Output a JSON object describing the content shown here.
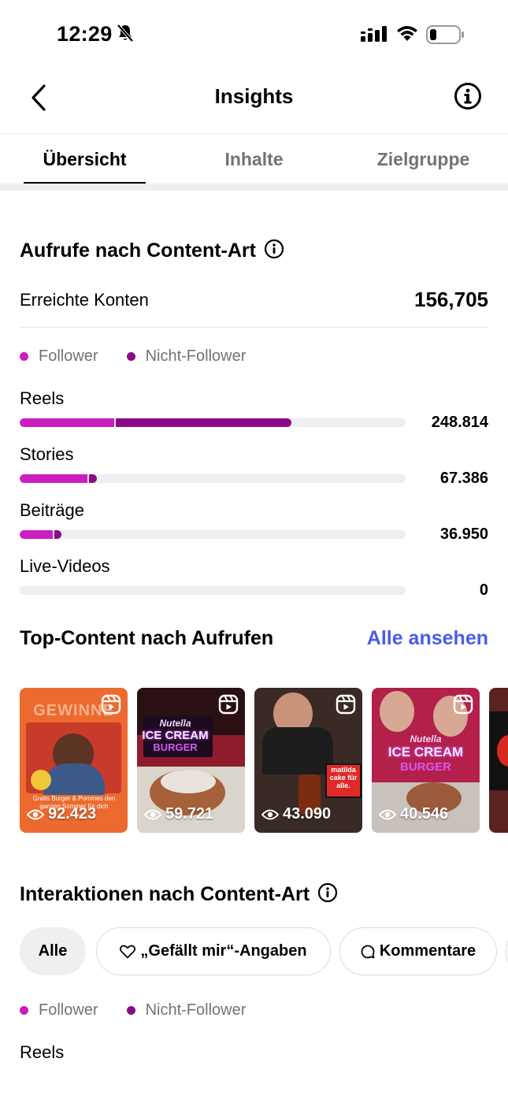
{
  "status_bar": {
    "time": "12:29"
  },
  "header": {
    "title": "Insights"
  },
  "tabs": [
    {
      "label": "Übersicht",
      "active": true
    },
    {
      "label": "Inhalte",
      "active": false
    },
    {
      "label": "Zielgruppe",
      "active": false
    }
  ],
  "views_section": {
    "title": "Aufrufe nach Content-Art",
    "reach_label": "Erreichte Konten",
    "reach_value": "156,705",
    "legend": {
      "follower": "Follower",
      "non_follower": "Nicht-Follower"
    },
    "colors": {
      "follower": "#cc1dbf",
      "non_follower": "#8b0b86"
    },
    "rows": [
      {
        "label": "Reels",
        "value": "248.814",
        "follower_pct": 24.5,
        "non_follower_pct": 45.5
      },
      {
        "label": "Stories",
        "value": "67.386",
        "follower_pct": 17.5,
        "non_follower_pct": 2.0
      },
      {
        "label": "Beiträge",
        "value": "36.950",
        "follower_pct": 8.5,
        "non_follower_pct": 2.0
      },
      {
        "label": "Live-Videos",
        "value": "0",
        "follower_pct": 0,
        "non_follower_pct": 0
      }
    ]
  },
  "top_content": {
    "title": "Top-Content nach Aufrufen",
    "see_all": "Alle ansehen",
    "items": [
      {
        "views": "92.423",
        "overlay_top": "GEWINNE",
        "overlay_caption": "Gratis Burger & Pommes den ganzen Sommer für dich"
      },
      {
        "views": "59.721",
        "overlay_top": "Nutella",
        "overlay_main": "ICE CREAM",
        "overlay_sub": "BURGER"
      },
      {
        "views": "43.090",
        "overlay_sign": "matilda cake für alle."
      },
      {
        "views": "40.546",
        "overlay_top": "Nutella",
        "overlay_main": "ICE CREAM",
        "overlay_sub": "BURGER"
      }
    ]
  },
  "interactions_section": {
    "title": "Interaktionen nach Content-Art",
    "chips": [
      {
        "label": "Alle",
        "selected": true,
        "icon": ""
      },
      {
        "label": "„Gefällt mir“-Angaben",
        "selected": false,
        "icon": "heart-icon"
      },
      {
        "label": "Kommentare",
        "selected": false,
        "icon": "comment-icon"
      }
    ],
    "legend": {
      "follower": "Follower",
      "non_follower": "Nicht-Follower"
    },
    "first_row_label": "Reels"
  }
}
